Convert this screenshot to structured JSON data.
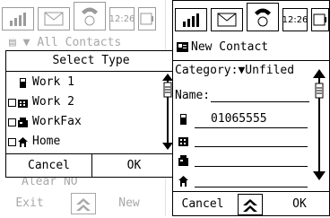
{
  "left_screen": {
    "status": {
      "time": "12:26"
    },
    "background_list": {
      "header": "All Contacts",
      "bottom_row": "Alear NO"
    },
    "dialog": {
      "title": "Select Type",
      "items": [
        {
          "label": "Work 1",
          "icon": "phone-icon",
          "checked": false
        },
        {
          "label": "Work 2",
          "icon": "building-icon",
          "checked": false
        },
        {
          "label": "WorkFax",
          "icon": "fax-icon",
          "checked": false
        },
        {
          "label": "Home",
          "icon": "house-icon",
          "checked": false
        }
      ],
      "cancel_label": "Cancel",
      "ok_label": "OK"
    },
    "softkeys": {
      "left": "Exit",
      "right": "New"
    }
  },
  "right_screen": {
    "status": {
      "time": "12:26"
    },
    "title": "New Contact",
    "category_label": "Category:",
    "category_value": "Unfiled",
    "name_label": "Name:",
    "name_value": "",
    "phone_value": "01065555",
    "softkeys": {
      "left": "Cancel",
      "right": "OK"
    }
  },
  "colors": {
    "foreground": "#000000",
    "disabled": "#a8a8a8",
    "background": "#ffffff"
  }
}
